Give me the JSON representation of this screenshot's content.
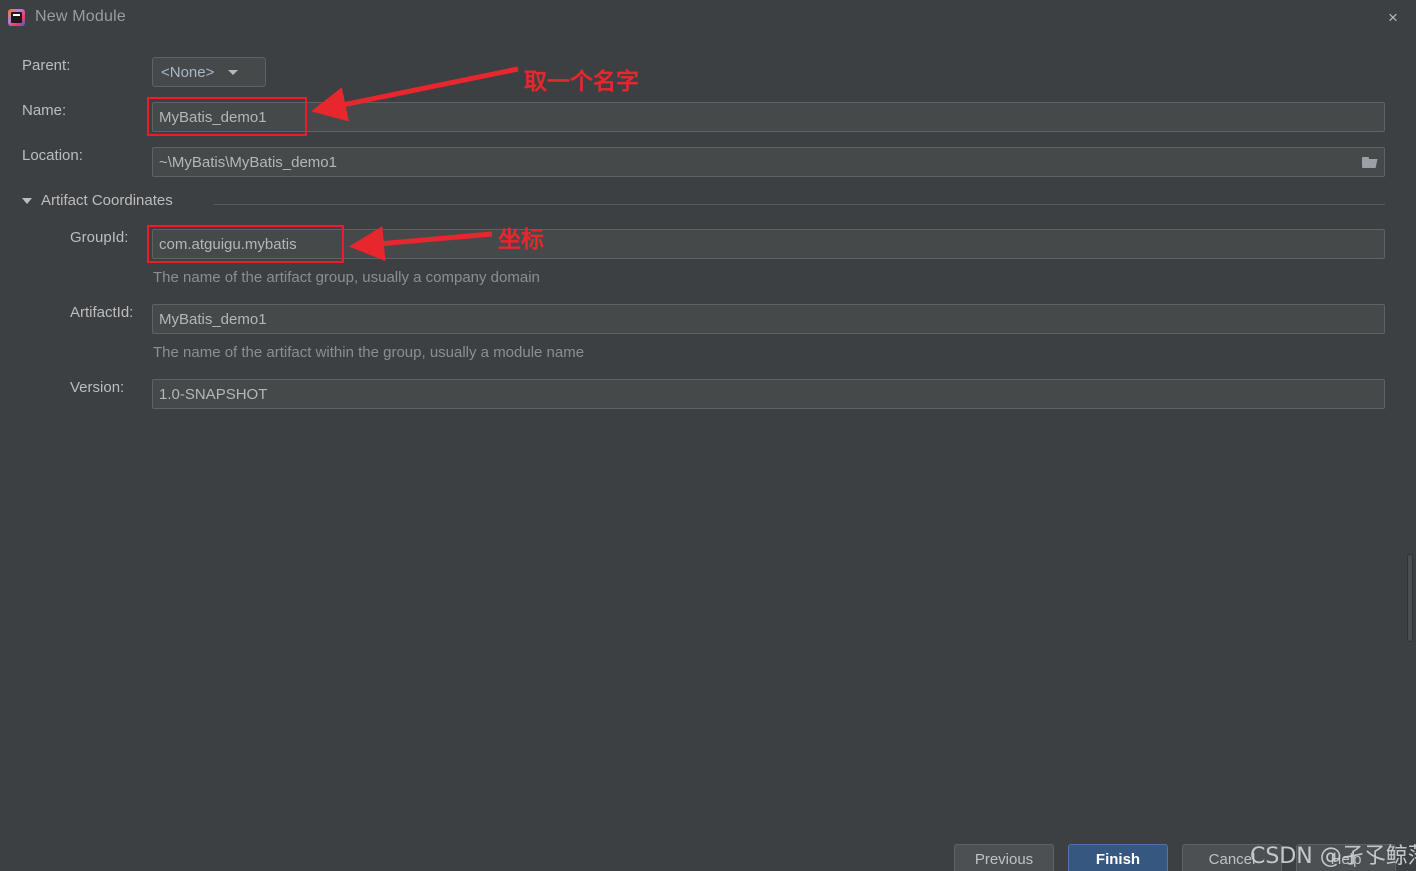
{
  "window": {
    "title": "New Module",
    "icon": "intellij-idea-icon",
    "close_label": "×"
  },
  "colors": {
    "dialog_bg": "#3c4043",
    "field_bg": "#45494a",
    "field_border": "#5e6263",
    "text": "#bdbdbd",
    "hint_text": "#8c8f91",
    "accent_primary": "#365880",
    "annotation_red": "#e8262d"
  },
  "form": {
    "parent": {
      "label": "Parent:",
      "value": "<None>",
      "options": [
        "<None>"
      ]
    },
    "name": {
      "label": "Name:",
      "value": "MyBatis_demo1",
      "placeholder": "Name"
    },
    "location": {
      "label": "Location:",
      "value": "~\\MyBatis\\MyBatis_demo1",
      "placeholder": "Location",
      "browse_icon": "folder-icon"
    }
  },
  "artifact_section": {
    "title": "Artifact Coordinates",
    "expanded": true,
    "group_id": {
      "label": "GroupId:",
      "value": "com.atguigu.mybatis",
      "hint": "The name of the artifact group, usually a company domain"
    },
    "artifact_id": {
      "label": "ArtifactId:",
      "value": "MyBatis_demo1",
      "hint": "The name of the artifact within the group, usually a module name"
    },
    "version": {
      "label": "Version:",
      "value": "1.0-SNAPSHOT"
    }
  },
  "annotations": [
    {
      "text": "取一个名字",
      "target": "name-field"
    },
    {
      "text": "坐标",
      "target": "groupid-field"
    }
  ],
  "footer": {
    "previous_label": "Previous",
    "finish_label": "Finish",
    "cancel_label": "Cancel",
    "help_label": "Help"
  },
  "watermark": {
    "text": "CSDN @孑孓鲸落"
  }
}
